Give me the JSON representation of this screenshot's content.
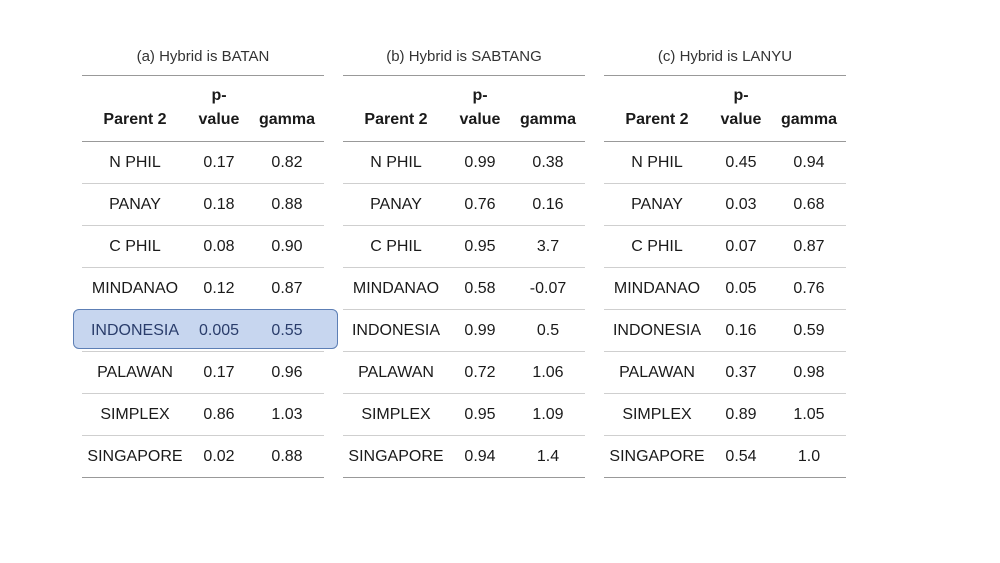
{
  "columns": {
    "parent": "Parent 2",
    "pvalue_line1": "p-",
    "pvalue_line2": "value",
    "gamma": "gamma"
  },
  "tables": [
    {
      "caption": "(a) Hybrid is BATAN",
      "highlight_row": 4,
      "rows": [
        {
          "parent": "N PHIL",
          "p": "0.17",
          "gamma": "0.82"
        },
        {
          "parent": "PANAY",
          "p": "0.18",
          "gamma": "0.88"
        },
        {
          "parent": "C PHIL",
          "p": "0.08",
          "gamma": "0.90"
        },
        {
          "parent": "MINDANAO",
          "p": "0.12",
          "gamma": "0.87"
        },
        {
          "parent": "INDONESIA",
          "p": "0.005",
          "gamma": "0.55"
        },
        {
          "parent": "PALAWAN",
          "p": "0.17",
          "gamma": "0.96"
        },
        {
          "parent": "SIMPLEX",
          "p": "0.86",
          "gamma": "1.03"
        },
        {
          "parent": "SINGAPORE",
          "p": "0.02",
          "gamma": "0.88"
        }
      ]
    },
    {
      "caption": "(b) Hybrid is SABTANG",
      "rows": [
        {
          "parent": "N PHIL",
          "p": "0.99",
          "gamma": "0.38"
        },
        {
          "parent": "PANAY",
          "p": "0.76",
          "gamma": "0.16"
        },
        {
          "parent": "C PHIL",
          "p": "0.95",
          "gamma": "3.7"
        },
        {
          "parent": "MINDANAO",
          "p": "0.58",
          "gamma": "-0.07"
        },
        {
          "parent": "INDONESIA",
          "p": "0.99",
          "gamma": "0.5"
        },
        {
          "parent": "PALAWAN",
          "p": "0.72",
          "gamma": "1.06"
        },
        {
          "parent": "SIMPLEX",
          "p": "0.95",
          "gamma": "1.09"
        },
        {
          "parent": "SINGAPORE",
          "p": "0.94",
          "gamma": "1.4"
        }
      ]
    },
    {
      "caption": "(c) Hybrid is LANYU",
      "rows": [
        {
          "parent": "N PHIL",
          "p": "0.45",
          "gamma": "0.94"
        },
        {
          "parent": "PANAY",
          "p": "0.03",
          "gamma": "0.68"
        },
        {
          "parent": "C PHIL",
          "p": "0.07",
          "gamma": "0.87"
        },
        {
          "parent": "MINDANAO",
          "p": "0.05",
          "gamma": "0.76"
        },
        {
          "parent": "INDONESIA",
          "p": "0.16",
          "gamma": "0.59"
        },
        {
          "parent": "PALAWAN",
          "p": "0.37",
          "gamma": "0.98"
        },
        {
          "parent": "SIMPLEX",
          "p": "0.89",
          "gamma": "1.05"
        },
        {
          "parent": "SINGAPORE",
          "p": "0.54",
          "gamma": "1.0"
        }
      ]
    }
  ],
  "colors": {
    "highlight_fill": "#c7d6ef",
    "highlight_border": "#5d7fb5"
  }
}
